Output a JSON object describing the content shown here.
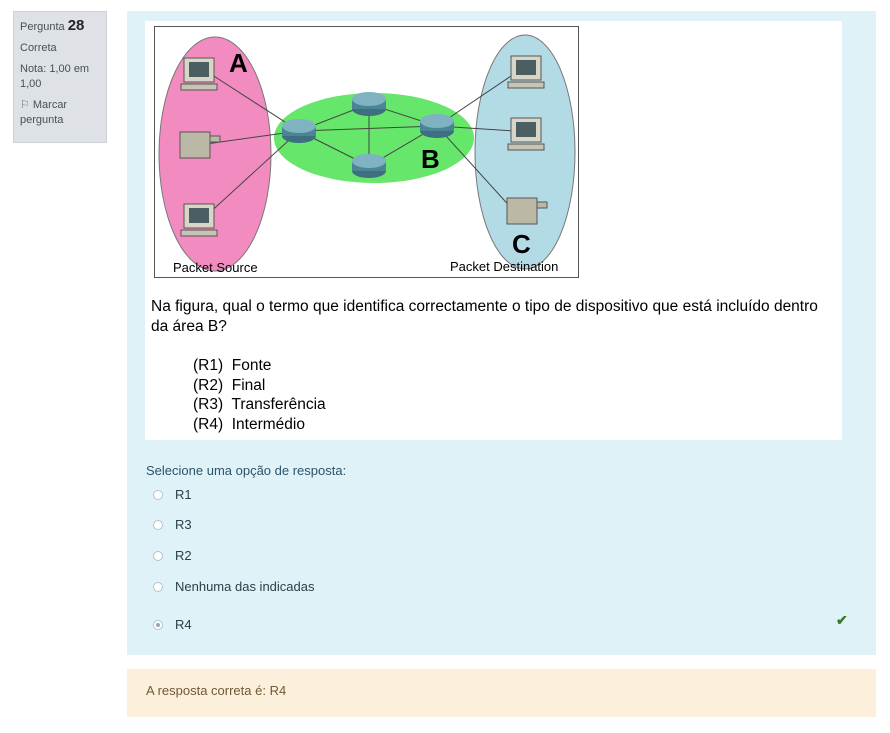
{
  "info": {
    "question_label": "Pergunta",
    "question_number": "28",
    "state": "Correta",
    "grade": "Nota: 1,00 em 1,00",
    "flag_label": "Marcar pergunta",
    "flag_icon": "flag-icon"
  },
  "figure": {
    "label_a": "A",
    "label_b": "B",
    "label_c": "C",
    "source_label": "Packet Source",
    "destination_label": "Packet Destination",
    "colors": {
      "source_area": "#f28cc0",
      "network_area": "#66e66a",
      "destination_area": "#b3dbe6"
    }
  },
  "question": {
    "prompt": "Na figura, qual o termo que identifica correctamente o tipo de dispositivo que está incluído dentro da área B?",
    "options": [
      "(R1)  Fonte",
      "(R2)  Final",
      "(R3)  Transferência",
      "(R4)  Intermédio"
    ]
  },
  "answer": {
    "select_label": "Selecione uma opção de resposta:",
    "choices": [
      {
        "label": "R1",
        "selected": false
      },
      {
        "label": "R3",
        "selected": false
      },
      {
        "label": "R2",
        "selected": false
      },
      {
        "label": "Nenhuma das indicadas",
        "selected": false
      },
      {
        "label": "R4",
        "selected": true
      }
    ],
    "correct_icon": "check-icon"
  },
  "feedback": {
    "text": "A resposta correta é: R4"
  }
}
